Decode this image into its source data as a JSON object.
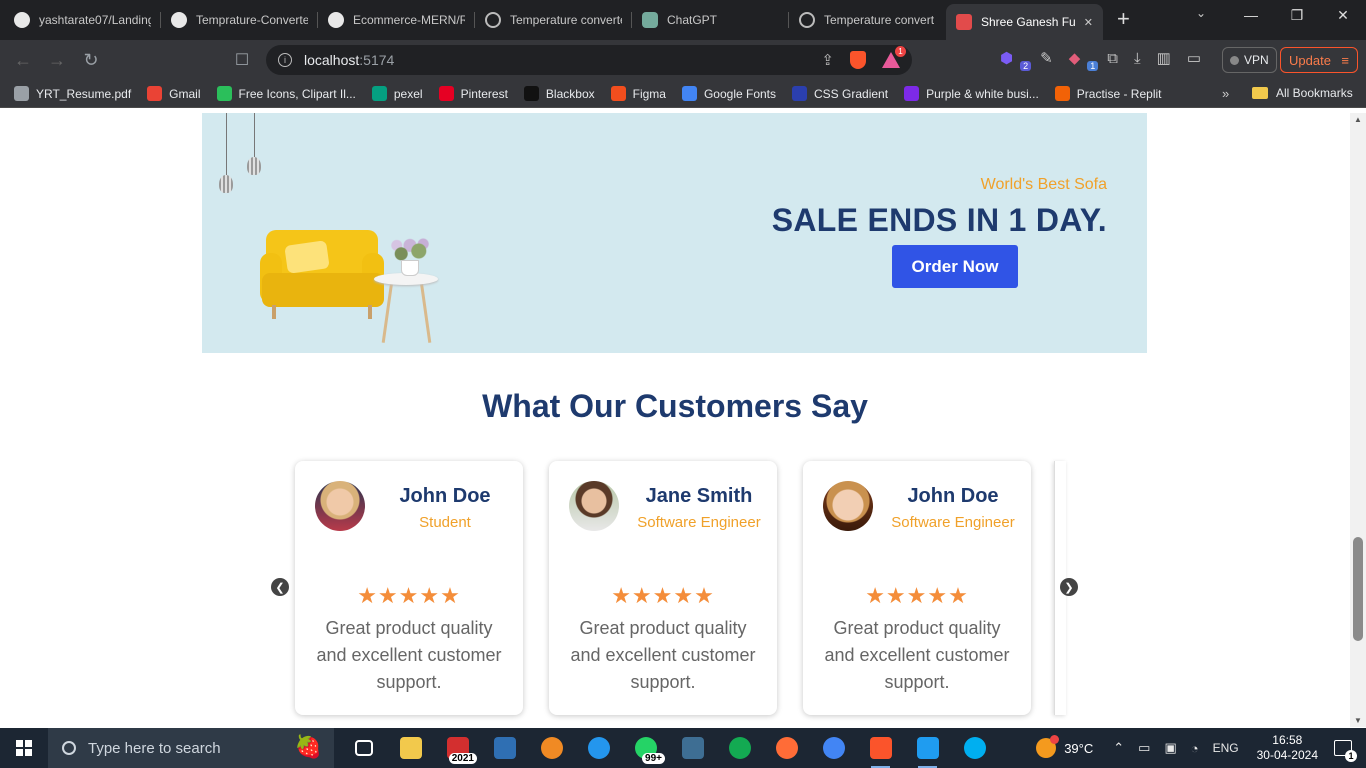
{
  "browser": {
    "tabs": [
      {
        "label": "yashtarate07/Landing",
        "icon": "github-icon"
      },
      {
        "label": "Temprature-Converte",
        "icon": "github-icon"
      },
      {
        "label": "Ecommerce-MERN/R",
        "icon": "github-icon"
      },
      {
        "label": "Temperature converte",
        "icon": "globe-icon"
      },
      {
        "label": "ChatGPT",
        "icon": "chatgpt-icon"
      },
      {
        "label": "Temperature convert",
        "icon": "globe-icon"
      },
      {
        "label": "Shree Ganesh Fu",
        "icon": "site-favicon",
        "active": true
      }
    ],
    "new_tab": "+",
    "address": {
      "host": "localhost",
      "port": ":5174"
    },
    "shields_badge": "1",
    "ext_badge_a": "2",
    "ext_badge_b": "1",
    "vpn_label": "VPN",
    "update_label": "Update",
    "bookmarks": [
      {
        "label": "YRT_Resume.pdf",
        "color": "#9aa0a6"
      },
      {
        "label": "Gmail",
        "color": "#ea4335"
      },
      {
        "label": "Free Icons, Clipart Il...",
        "color": "#2bbf5b"
      },
      {
        "label": "pexel",
        "color": "#05a081"
      },
      {
        "label": "Pinterest",
        "color": "#e60023"
      },
      {
        "label": "Blackbox",
        "color": "#111111"
      },
      {
        "label": "Figma",
        "color": "#f24e1e"
      },
      {
        "label": "Google Fonts",
        "color": "#4285f4"
      },
      {
        "label": "CSS Gradient",
        "color": "#2b3fae"
      },
      {
        "label": "Purple & white busi...",
        "color": "#7d2ae8"
      },
      {
        "label": "Practise - Replit",
        "color": "#f26207"
      }
    ],
    "bookmarks_more": "»",
    "all_bookmarks": "All Bookmarks"
  },
  "banner": {
    "subtitle": "World's Best Sofa",
    "title": "SALE ENDS IN 1 DAY.",
    "order_button": "Order Now"
  },
  "testimonials": {
    "heading": "What Our Customers Say",
    "cards": [
      {
        "name": "John Doe",
        "role": "Student",
        "stars": "★★★★★",
        "quote": "Great product quality and excellent customer support."
      },
      {
        "name": "Jane Smith",
        "role": "Software Engineer",
        "stars": "★★★★★",
        "quote": "Great product quality and excellent customer support."
      },
      {
        "name": "John Doe",
        "role": "Software Engineer",
        "stars": "★★★★★",
        "quote": "Great product quality and excellent customer support."
      }
    ],
    "rating": 5,
    "prev_arrow": "❮",
    "next_arrow": "❯"
  },
  "taskbar": {
    "search_placeholder": "Type here to search",
    "apps": [
      {
        "name": "task-view",
        "color": "#ffffff"
      },
      {
        "name": "file-explorer",
        "color": "#f2c94c"
      },
      {
        "name": "solidworks",
        "color": "#d32f2f",
        "label": "2021"
      },
      {
        "name": "virtualbox",
        "color": "#2f6fb3"
      },
      {
        "name": "vlc",
        "color": "#f08a24"
      },
      {
        "name": "docker",
        "color": "#2496ed"
      },
      {
        "name": "whatsapp",
        "color": "#25d366",
        "label": "99+"
      },
      {
        "name": "mysql-workbench",
        "color": "#3e6e93"
      },
      {
        "name": "mongodb",
        "color": "#13aa52"
      },
      {
        "name": "postman",
        "color": "#ff6c37"
      },
      {
        "name": "chrome",
        "color": "#4285f4"
      },
      {
        "name": "brave",
        "color": "#fb542b",
        "running": true
      },
      {
        "name": "vscode",
        "color": "#1f9cf0",
        "running": true
      },
      {
        "name": "skype",
        "color": "#00aff0"
      }
    ],
    "temperature": "39°C",
    "language": "ENG",
    "time": "16:58",
    "date": "30-04-2024",
    "notification_count": "1"
  }
}
